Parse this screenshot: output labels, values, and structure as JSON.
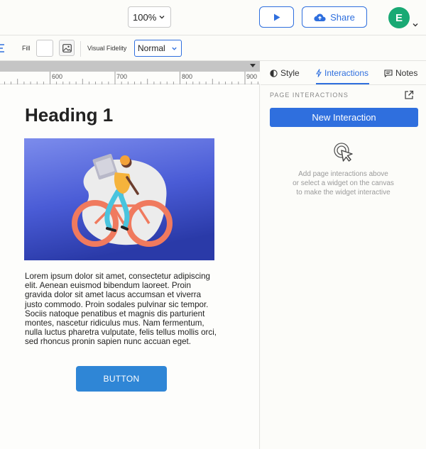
{
  "topbar": {
    "zoom_value": "100%",
    "share_label": "Share",
    "avatar_initial": "E"
  },
  "toolbar": {
    "fill_label": "Fill",
    "visual_fidelity_label": "Visual Fidelity",
    "visual_fidelity_value": "Normal"
  },
  "ruler": {
    "labels": [
      "600",
      "700",
      "800",
      "900"
    ]
  },
  "canvas": {
    "heading": "Heading 1",
    "paragraph": "Lorem ipsum dolor sit amet, consectetur adipiscing elit. Aenean euismod bibendum laoreet. Proin gravida dolor sit amet lacus accumsan et viverra justo commodo. Proin sodales pulvinar sic tempor. Sociis natoque penatibus et magnis dis parturient montes, nascetur ridiculus mus. Nam fermentum, nulla luctus pharetra vulputate, felis tellus mollis orci, sed rhoncus pronin sapien nunc accuan eget.",
    "button_label": "BUTTON"
  },
  "panel": {
    "tabs": [
      {
        "label": "Style",
        "icon": "style-icon"
      },
      {
        "label": "Interactions",
        "icon": "lightning-icon"
      },
      {
        "label": "Notes",
        "icon": "notes-icon"
      }
    ],
    "active_tab": "Interactions",
    "section_title": "PAGE INTERACTIONS",
    "new_interaction_label": "New Interaction",
    "hint_lines": [
      "Add page interactions above",
      "or select a widget on the canvas",
      "to make the widget interactive"
    ]
  },
  "colors": {
    "accent": "#2f6fde",
    "avatar": "#19a974",
    "canvas_button": "#2f86d6"
  }
}
